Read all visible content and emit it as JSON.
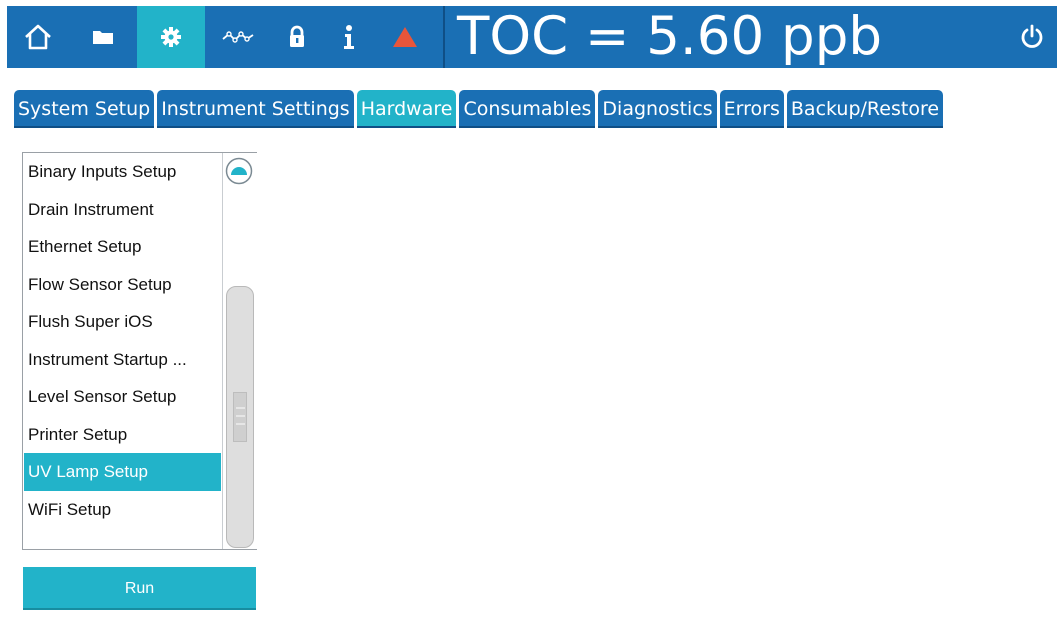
{
  "header": {
    "toc_text": "TOC = 5.60 ppb",
    "icons": [
      "home-icon",
      "folder-icon",
      "gear-icon",
      "trend-icon",
      "lock-icon",
      "info-icon",
      "alert-triangle-icon",
      "power-icon"
    ],
    "colors": {
      "bar": "#1a6fb4",
      "active": "#22b3c9",
      "alert": "#e8553a"
    }
  },
  "tabs": [
    {
      "label": "System Setup"
    },
    {
      "label": "Instrument Settings"
    },
    {
      "label": "Hardware",
      "active": true
    },
    {
      "label": "Consumables"
    },
    {
      "label": "Diagnostics"
    },
    {
      "label": "Errors"
    },
    {
      "label": "Backup/Restore"
    }
  ],
  "list": {
    "items": [
      {
        "label": "Binary Inputs Setup"
      },
      {
        "label": "Drain Instrument"
      },
      {
        "label": "Ethernet Setup"
      },
      {
        "label": "Flow Sensor Setup"
      },
      {
        "label": "Flush Super iOS"
      },
      {
        "label": "Instrument Startup ..."
      },
      {
        "label": "Level Sensor Setup"
      },
      {
        "label": "Printer Setup"
      },
      {
        "label": "UV Lamp Setup",
        "selected": true
      },
      {
        "label": "WiFi Setup"
      }
    ]
  },
  "run_button": {
    "label": "Run"
  }
}
